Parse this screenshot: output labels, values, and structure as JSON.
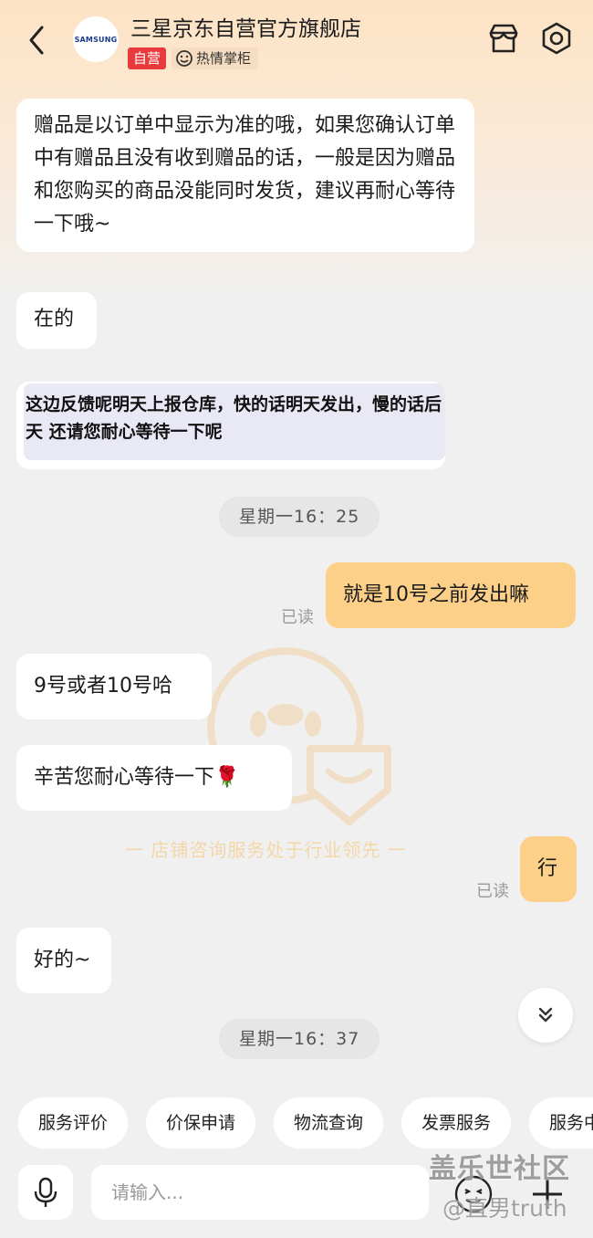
{
  "header": {
    "shop_name": "三星京东自营官方旗舰店",
    "avatar_text": "SAMSUNG",
    "badge_self": "自营",
    "badge_host": "热情掌柜",
    "brand_color": "#e93b3d"
  },
  "messages": [
    {
      "from": "shop",
      "text": "赠品是以订单中显示为准的哦，如果您确认订单中有赠品且没有收到赠品的话，一般是因为赠品和您购买的商品没能同时发货，建议再耐心等待一下哦~"
    },
    {
      "from": "shop",
      "text": "在的"
    },
    {
      "from": "shop",
      "type": "image",
      "text": "这边反馈呢明天上报仓库，快的话明天发出，慢的话后天 还请您耐心等待一下呢"
    },
    {
      "type": "time",
      "text": "星期一16：25"
    },
    {
      "from": "me",
      "text": "就是10号之前发出嘛",
      "status": "已读"
    },
    {
      "from": "shop",
      "text": "9号或者10号哈"
    },
    {
      "from": "shop",
      "text": "辛苦您耐心等待一下🌹"
    },
    {
      "from": "me",
      "text": "行",
      "status": "已读"
    },
    {
      "from": "shop",
      "text": "好的~"
    },
    {
      "type": "time",
      "text": "星期一16：37"
    }
  ],
  "watermark_slogan": "一  店铺咨询服务处于行业领先  一",
  "quick_replies": [
    "服务评价",
    "价保申请",
    "物流查询",
    "发票服务",
    "服务中"
  ],
  "input": {
    "placeholder": "请输入..."
  },
  "overlay_watermarks": {
    "site": "盖乐世社区",
    "user": "@直男truth"
  },
  "colors": {
    "my_bubble": "#fdd08a",
    "background": "#f0f0f0"
  }
}
